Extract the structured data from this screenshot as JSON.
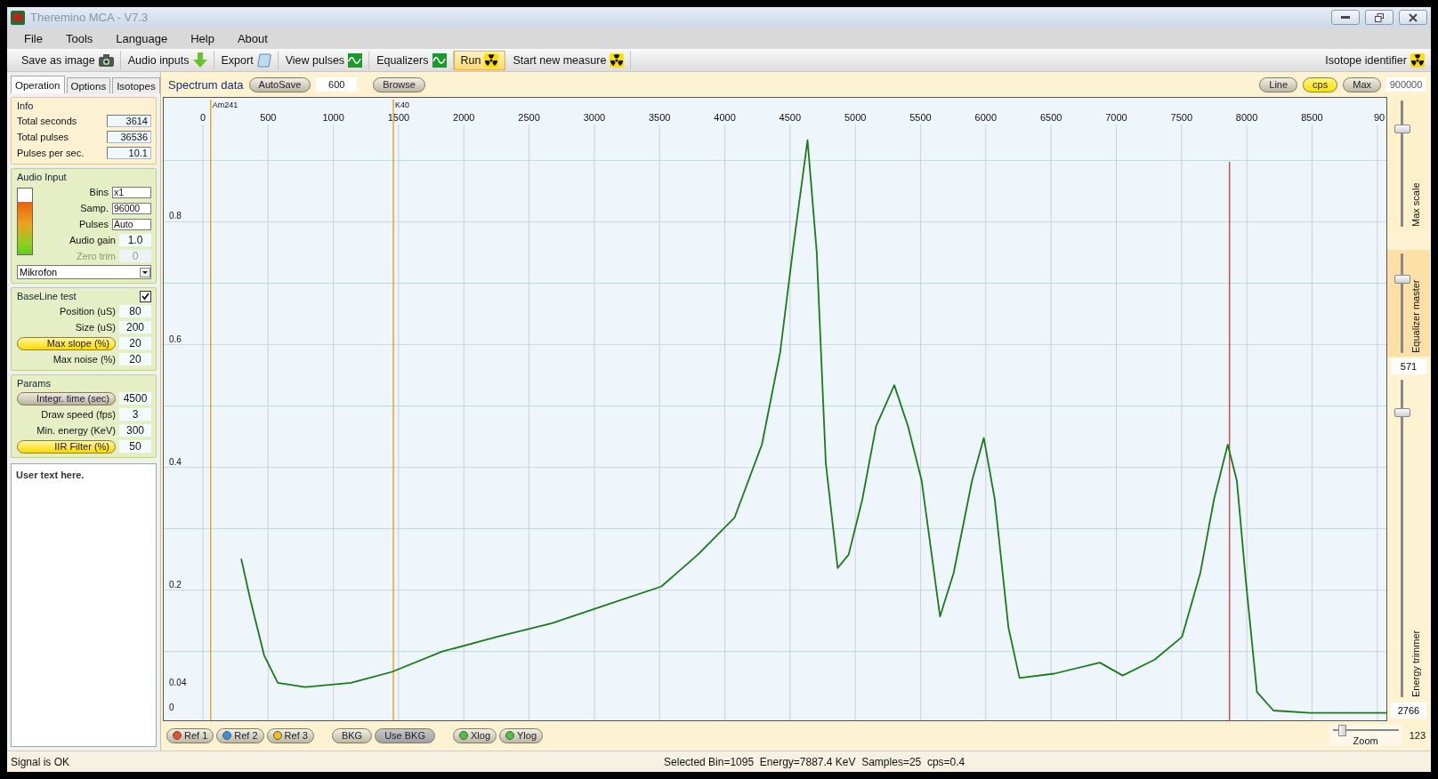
{
  "window": {
    "title": "Theremino MCA - V7.3"
  },
  "menu": [
    "File",
    "Tools",
    "Language",
    "Help",
    "About"
  ],
  "toolbar": [
    {
      "label": "Save as image",
      "selected": false
    },
    {
      "label": "Audio inputs",
      "selected": false
    },
    {
      "label": "Export",
      "selected": false
    },
    {
      "label": "View pulses",
      "selected": false
    },
    {
      "label": "Equalizers",
      "selected": false
    },
    {
      "label": "Run",
      "selected": true
    },
    {
      "label": "Start new measure",
      "selected": false
    }
  ],
  "isotope_identifier": "Isotope identifier",
  "left_panel": {
    "tabs": [
      {
        "label": "Operation",
        "selected": true
      },
      {
        "label": "Options",
        "selected": false
      },
      {
        "label": "Isotopes",
        "selected": false
      }
    ],
    "info": {
      "title": "Info",
      "rows": [
        {
          "label": "Total seconds",
          "value": "3614"
        },
        {
          "label": "Total pulses",
          "value": "36536"
        },
        {
          "label": "Pulses per sec.",
          "value": "10.1"
        }
      ]
    },
    "audio_input": {
      "title": "Audio Input",
      "level": 0.8,
      "fields": [
        {
          "label": "Bins",
          "value": "x1",
          "kind": "combo",
          "disabled": false
        },
        {
          "label": "Samp.",
          "value": "96000",
          "kind": "combo",
          "disabled": false
        },
        {
          "label": "Pulses",
          "value": "Auto",
          "kind": "combo",
          "disabled": false
        },
        {
          "label": "Audio gain",
          "value": "1.0",
          "kind": "number",
          "disabled": false
        },
        {
          "label": "Zero trim",
          "value": "0",
          "kind": "number",
          "disabled": true
        }
      ],
      "device": "Mikrofon"
    },
    "baseline": {
      "title": "BaseLine test",
      "checked": true,
      "rows": [
        {
          "label": "Position (uS)",
          "value": "80",
          "kind": "label"
        },
        {
          "label": "Size (uS)",
          "value": "200",
          "kind": "label"
        },
        {
          "label": "Max slope (%)",
          "value": "20",
          "kind": "button",
          "on": true
        },
        {
          "label": "Max noise (%)",
          "value": "20",
          "kind": "label"
        }
      ]
    },
    "params": {
      "title": "Params",
      "rows": [
        {
          "label": "Integr. time (sec)",
          "value": "4500",
          "kind": "button",
          "on": false
        },
        {
          "label": "Draw speed (fps)",
          "value": "3",
          "kind": "label"
        },
        {
          "label": "Min. energy (KeV)",
          "value": "300",
          "kind": "label"
        },
        {
          "label": "IIR Filter (%)",
          "value": "50",
          "kind": "button",
          "on": true
        }
      ]
    },
    "user_text": "User text here."
  },
  "spectrum": {
    "title": "Spectrum data",
    "autosave_button": "AutoSave",
    "autosave_value": "600",
    "browse_button": "Browse",
    "mode_buttons": [
      {
        "label": "Line",
        "on": false
      },
      {
        "label": "cps",
        "on": true
      },
      {
        "label": "Max",
        "on": false
      }
    ],
    "max_value": "900000",
    "chart_data": {
      "type": "line",
      "xlim": [
        -300,
        9070
      ],
      "ylim": [
        -0.012,
        1.002
      ],
      "xticks": [
        0,
        500,
        1000,
        1500,
        2000,
        2500,
        3000,
        3500,
        4000,
        4500,
        5000,
        5500,
        6000,
        6500,
        7000,
        7500,
        8000,
        8500
      ],
      "yticks": [
        0,
        0.04,
        0.2,
        0.4,
        0.6,
        0.8
      ],
      "x": [
        294,
        364,
        469,
        574,
        784,
        1134,
        1449,
        1834,
        2254,
        2674,
        3094,
        3514,
        3794,
        4074,
        4284,
        4424,
        4529,
        4634,
        4704,
        4774,
        4865,
        4949,
        5054,
        5159,
        5299,
        5404,
        5509,
        5649,
        5754,
        5894,
        5985,
        6069,
        6174,
        6258,
        6524,
        6874,
        7049,
        7294,
        7504,
        7644,
        7749,
        7854,
        7924,
        7994,
        8078,
        8204,
        8484,
        9069
      ],
      "series": [
        {
          "color": "#1a7a1a",
          "values": [
            0.251,
            0.184,
            0.094,
            0.049,
            0.042,
            0.049,
            0.067,
            0.1,
            0.124,
            0.146,
            0.176,
            0.206,
            0.258,
            0.318,
            0.437,
            0.587,
            0.766,
            0.933,
            0.751,
            0.407,
            0.236,
            0.258,
            0.348,
            0.467,
            0.534,
            0.467,
            0.378,
            0.157,
            0.228,
            0.378,
            0.448,
            0.348,
            0.139,
            0.057,
            0.064,
            0.082,
            0.061,
            0.087,
            0.124,
            0.228,
            0.348,
            0.437,
            0.378,
            0.213,
            0.034,
            0.004,
            0.0,
            0.0
          ]
        }
      ],
      "grid": true,
      "ref_lines": [
        {
          "axis": "x",
          "value": 60,
          "label": "Am241",
          "color": "#e8a820"
        },
        {
          "axis": "x",
          "value": 1460,
          "label": "K40",
          "color": "#e8a820"
        },
        {
          "axis": "x",
          "value": 7868,
          "color": "#e02020"
        }
      ]
    },
    "edge_tick_label": "90",
    "sliders": [
      {
        "label": "Max scale",
        "level": 0.78
      },
      {
        "label": "Equalizer master",
        "level": 0.75,
        "value": "571"
      },
      {
        "label": "Energy trimmer",
        "level": 0.9,
        "value": "2766"
      }
    ],
    "footer_buttons": [
      {
        "label": "Ref 1",
        "kind": "dot",
        "color": "#e8502a"
      },
      {
        "label": "Ref 2",
        "kind": "dot",
        "color": "#3a8ee0"
      },
      {
        "label": "Ref 3",
        "kind": "dot",
        "color": "#f0c020"
      },
      {
        "label": "BKG",
        "kind": "plain",
        "on": false
      },
      {
        "label": "Use BKG",
        "kind": "plain",
        "on": true
      },
      {
        "label": "Xlog",
        "kind": "dot",
        "color": "#50c040"
      },
      {
        "label": "Ylog",
        "kind": "dot",
        "color": "#50c040"
      }
    ],
    "zoom": {
      "label": "Zoom",
      "value": "123",
      "level": 0.12
    }
  },
  "status_bar": {
    "signal": "Signal is OK",
    "selection": "Selected Bin=1095  Energy=7887.4 KeV  Samples=25  cps=0.4"
  }
}
